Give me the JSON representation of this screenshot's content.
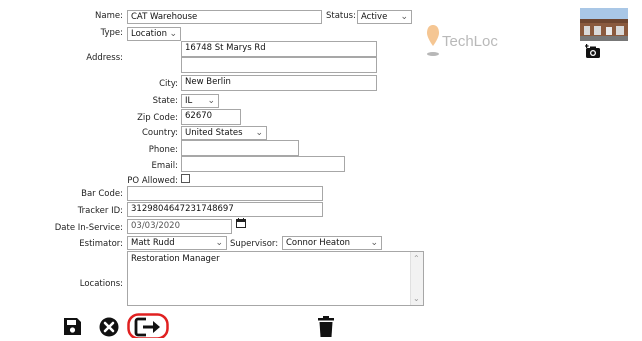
{
  "form": {
    "name": {
      "label": "Name:",
      "value": "CAT Warehouse"
    },
    "status": {
      "label": "Status:",
      "value": "Active"
    },
    "type": {
      "label": "Type:",
      "value": "Location"
    },
    "address": {
      "label": "Address:",
      "line1": "16748 St Marys Rd",
      "line2": ""
    },
    "city": {
      "label": "City:",
      "value": "New Berlin"
    },
    "state": {
      "label": "State:",
      "value": "IL"
    },
    "zip": {
      "label": "Zip Code:",
      "value": "62670"
    },
    "country": {
      "label": "Country:",
      "value": "United States"
    },
    "phone": {
      "label": "Phone:",
      "value": ""
    },
    "email": {
      "label": "Email:",
      "value": ""
    },
    "po_allowed": {
      "label": "PO Allowed:",
      "checked": false
    },
    "bar_code": {
      "label": "Bar Code:",
      "value": ""
    },
    "tracker_id": {
      "label": "Tracker ID:",
      "value": "3129804647231748697"
    },
    "date_in_service": {
      "label": "Date In-Service:",
      "value": "03/03/2020"
    },
    "estimator": {
      "label": "Estimator:",
      "value": "Matt Rudd"
    },
    "supervisor": {
      "label": "Supervisor:",
      "value": "Connor Heaton"
    },
    "locations": {
      "label": "Locations:",
      "value": "Restoration Manager"
    }
  },
  "watermark": {
    "text": "TechLoc"
  },
  "icons": {
    "save": "save-icon",
    "cancel": "cancel-icon",
    "exit": "exit-icon",
    "delete": "trash-icon",
    "calendar": "calendar-icon",
    "add_photo": "add-photo-icon",
    "location_pin": "location-pin-icon"
  },
  "colors": {
    "exit_highlight": "#e02020",
    "watermark": "#b9b9b9",
    "pin": "#f2b878"
  }
}
